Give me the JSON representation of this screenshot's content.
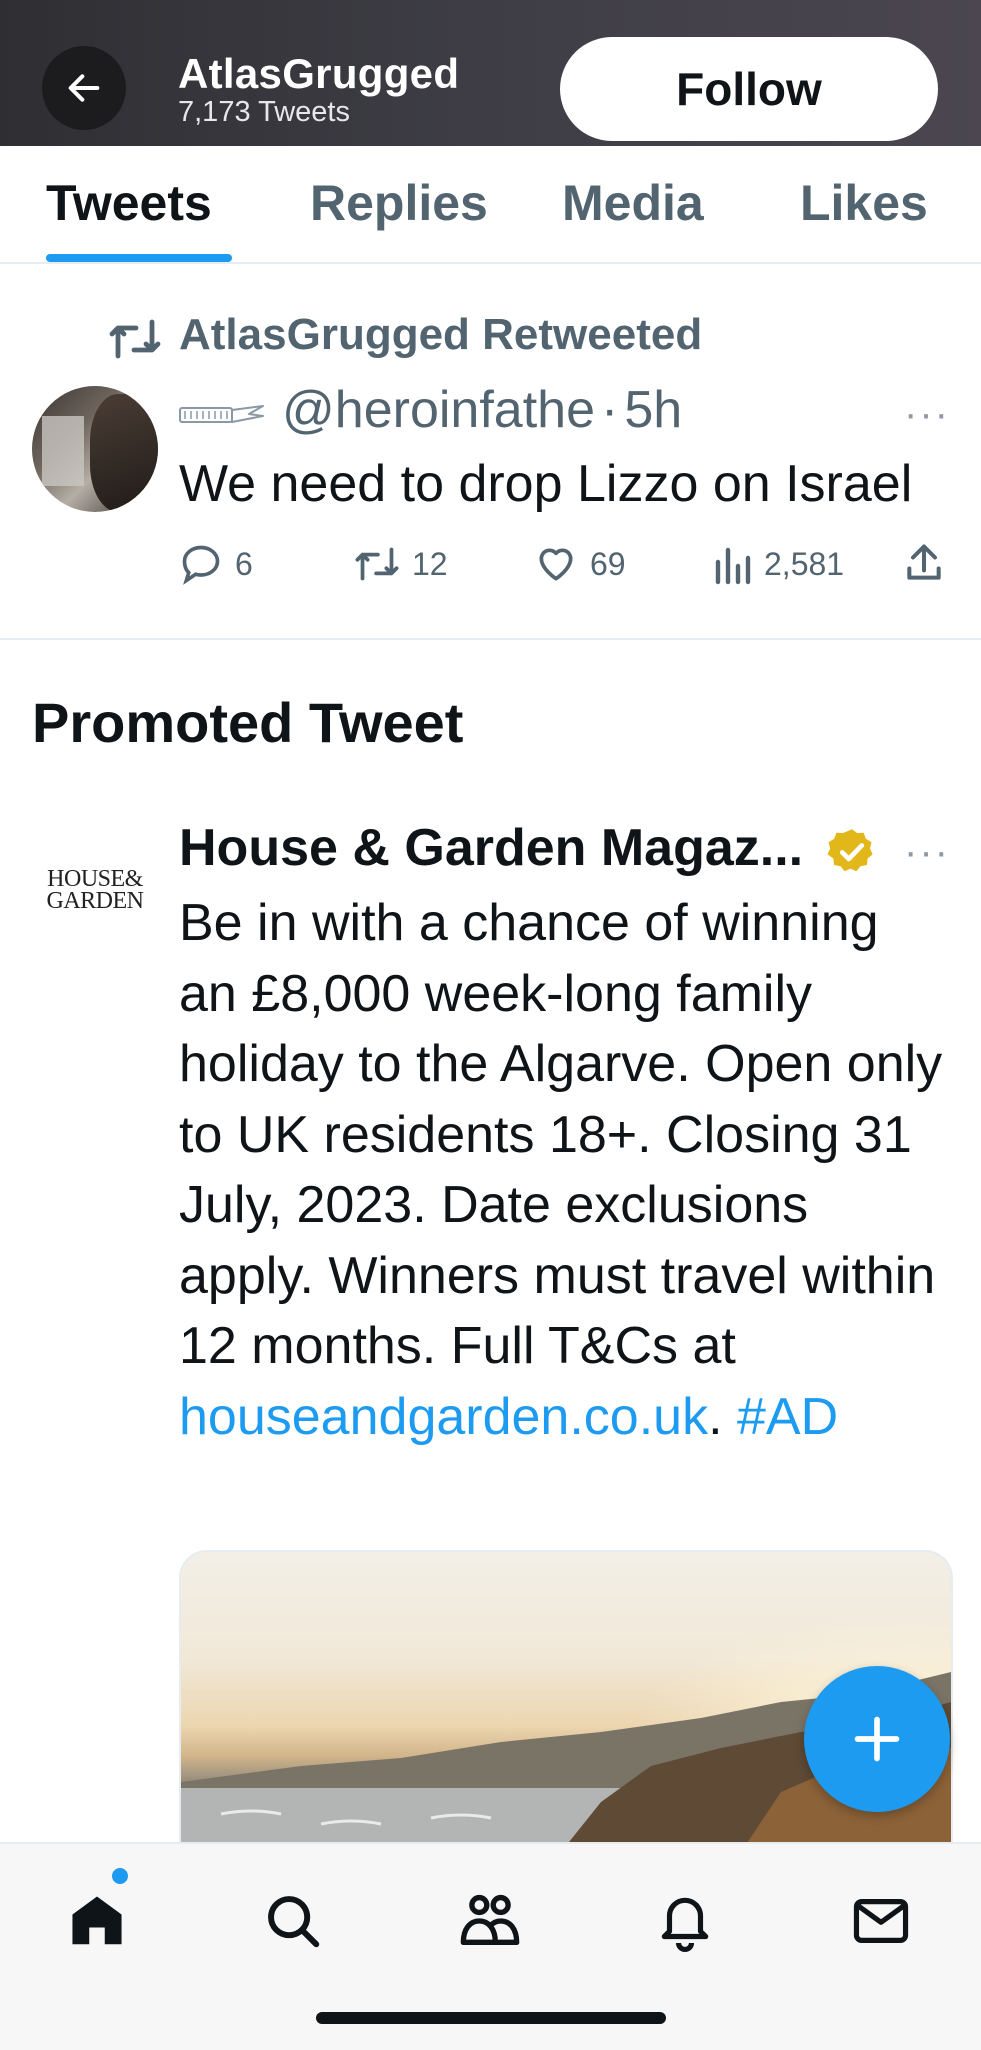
{
  "header": {
    "profile_name": "AtlasGrugged",
    "tweet_count": "7,173 Tweets",
    "follow_label": "Follow"
  },
  "tabs": [
    {
      "label": "Tweets",
      "active": true
    },
    {
      "label": "Replies",
      "active": false
    },
    {
      "label": "Media",
      "active": false
    },
    {
      "label": "Likes",
      "active": false
    }
  ],
  "retweeted_tweet": {
    "retweet_label": "AtlasGrugged Retweeted",
    "handle": "@heroinfathe",
    "separator": "·",
    "time": "5h",
    "more": "···",
    "text": "We need to drop Lizzo on Israel",
    "replies": "6",
    "retweets": "12",
    "likes": "69",
    "views": "2,581"
  },
  "promoted": {
    "section_title": "Promoted Tweet",
    "logo_line1": "HOUSE&",
    "logo_line2": "GARDEN",
    "author": "House & Garden Magaz...",
    "more": "···",
    "body": "Be in with a chance of winning an £8,000 week-long family holiday to the Algarve. Open only to UK residents 18+. Closing 31 July, 2023. Date exclusions apply. Winners must travel within 12 months. Full T&Cs at",
    "link_text": "houseandgarden.co.uk",
    "after_link": ". ",
    "hashtag": "#AD"
  },
  "colors": {
    "accent": "#1d9bf0",
    "secondary_text": "#536471",
    "verified_gold": "#e2b719"
  },
  "icons": {
    "back": "arrow-left-icon",
    "retweet": "retweet-icon",
    "reply": "reply-icon",
    "like": "heart-icon",
    "views": "views-icon",
    "share": "share-icon",
    "compose": "plus-icon",
    "nav": [
      "home-icon",
      "search-icon",
      "communities-icon",
      "bell-icon",
      "mail-icon"
    ]
  }
}
